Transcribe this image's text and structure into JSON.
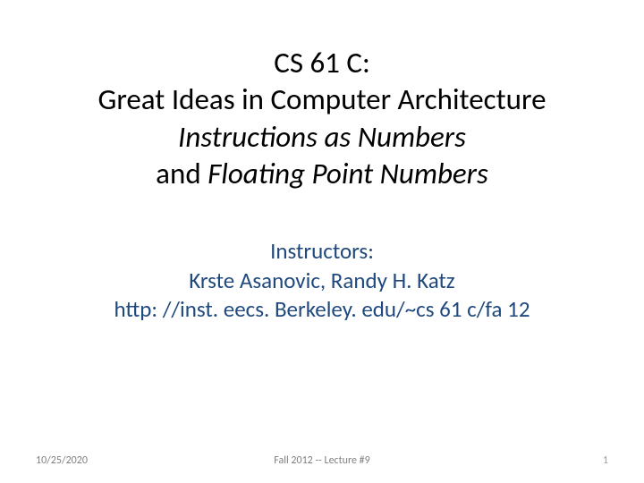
{
  "title": {
    "line1": "CS 61 C:",
    "line2": "Great Ideas in Computer Architecture",
    "line3": "Instructions as Numbers",
    "line4_and": "and ",
    "line4_fpn": "Floating Point Numbers"
  },
  "instructors": {
    "label": "Instructors:",
    "names": "Krste Asanovic, Randy H. Katz",
    "url": "http: //inst. eecs. Berkeley. edu/~cs 61 c/fa 12"
  },
  "footer": {
    "date": "10/25/2020",
    "lecture": "Fall 2012 -- Lecture #9",
    "page": "1"
  }
}
